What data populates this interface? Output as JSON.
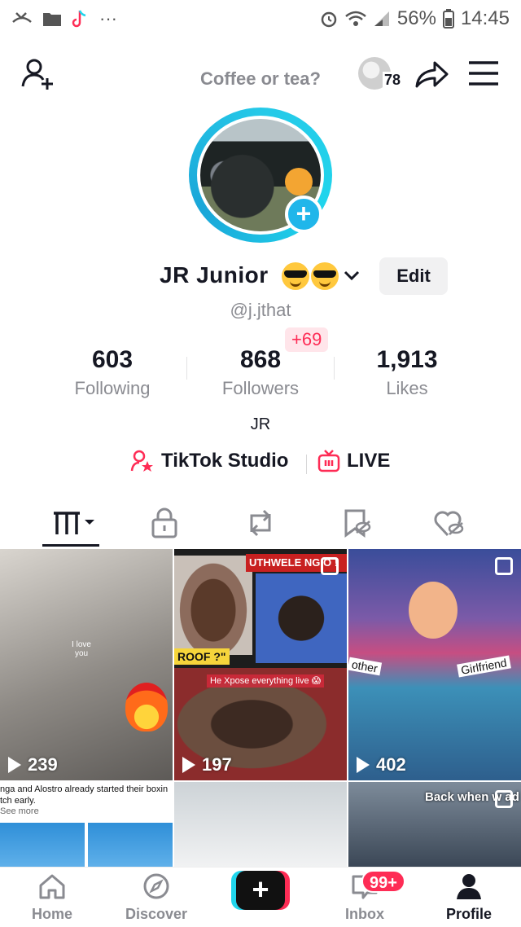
{
  "status_bar": {
    "battery_percent": "56%",
    "time": "14:45"
  },
  "top_bar": {
    "title": "Coffee or tea?",
    "coins_count": "78"
  },
  "profile": {
    "display_name": "JR  Junior",
    "handle": "@j.jthat",
    "edit_label": "Edit",
    "bio": "JR"
  },
  "stats": {
    "following": {
      "value": "603",
      "label": "Following"
    },
    "followers": {
      "value": "868",
      "label": "Followers",
      "new": "+69"
    },
    "likes": {
      "value": "1,913",
      "label": "Likes"
    }
  },
  "links": {
    "studio": "TikTok Studio",
    "live": "LIVE"
  },
  "tabs": [
    "videos",
    "private",
    "reposts",
    "favorites",
    "liked"
  ],
  "videos": [
    {
      "views": "239",
      "caption_lines": [
        "I love",
        "you"
      ]
    },
    {
      "views": "197",
      "overlay_top": "UTHWELE NG  O !",
      "overlay_roof": "ROOF ?\"",
      "overlay_expose": "He Xpose everything live 😱"
    },
    {
      "views": "402",
      "label_left": "other",
      "label_right": "Girlfriend"
    },
    {
      "caption": "nga and Alostro already started their boxin",
      "caption2": "tch early.",
      "see_more": "See more"
    },
    {},
    {
      "overlay": "Back when w   ad"
    }
  ],
  "bottom_nav": {
    "home": "Home",
    "discover": "Discover",
    "inbox": "Inbox",
    "inbox_badge": "99+",
    "profile": "Profile"
  },
  "colors": {
    "accent_red": "#fe2c55",
    "accent_cyan": "#20d5ec",
    "muted_text": "#8a8b91"
  }
}
